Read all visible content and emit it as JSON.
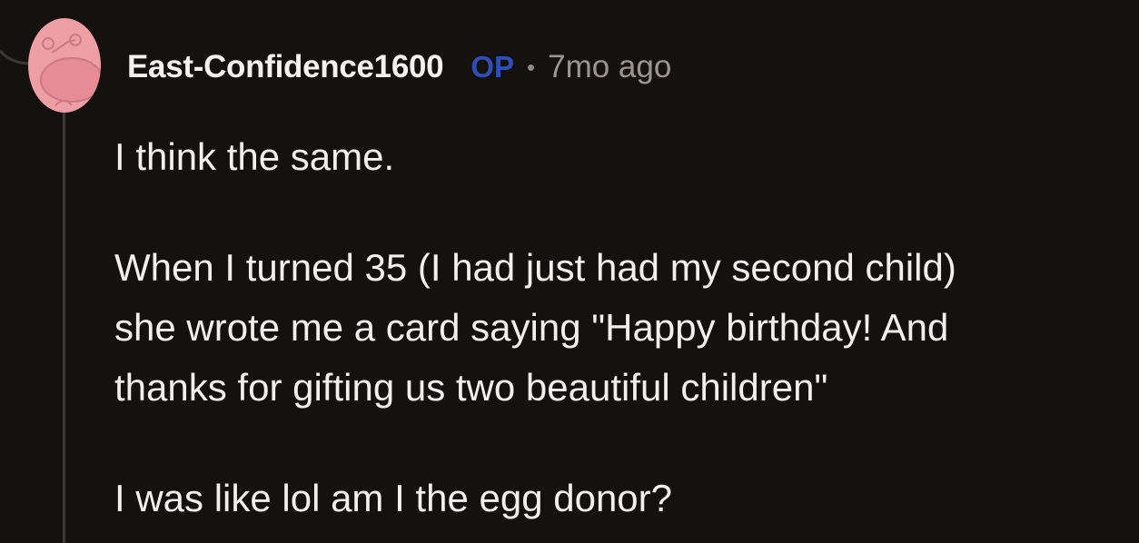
{
  "comment": {
    "username": "East-Confidence1600",
    "op_badge": "OP",
    "separator": "•",
    "timestamp": "7mo ago",
    "avatar_icon": "reddit-snoo-avatar-icon",
    "paragraphs": {
      "p1": "I think the same.",
      "p2": {
        "line1": "When I turned 35 (I had just had my second child)",
        "line2": "she wrote me a card saying \"Happy birthday! And",
        "line3": "thanks for gifting us two beautiful children\""
      },
      "p3": "I was like lol am I the egg donor?"
    }
  },
  "colors": {
    "background": "#14110f",
    "text": "#f2f0ee",
    "op_badge": "#2f4fb8",
    "timestamp": "#9b9692",
    "avatar_bg": "#ee9fa6",
    "thread_line": "#3b3734"
  }
}
